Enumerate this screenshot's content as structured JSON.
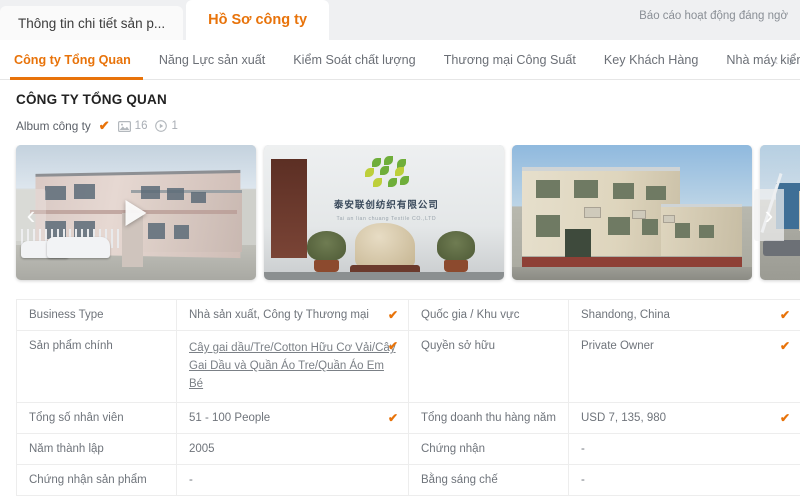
{
  "topbar": {
    "tabs": [
      {
        "label": "Thông tin chi tiết sản p...",
        "active": false
      },
      {
        "label": "Hồ Sơ công ty",
        "active": true
      }
    ],
    "report_link": "Báo cáo hoạt động đáng ngờ"
  },
  "nav": {
    "items": [
      {
        "label": "Công ty Tổng Quan",
        "active": true
      },
      {
        "label": "Năng Lực sản xuất",
        "active": false
      },
      {
        "label": "Kiểm Soát chất lượng",
        "active": false
      },
      {
        "label": "Thương mại Công Suất",
        "active": false
      },
      {
        "label": "Key Khách Hàng",
        "active": false
      },
      {
        "label": "Nhà máy kiểm tra",
        "active": false
      }
    ],
    "prev_arrow": "‹",
    "next_arrow": "›"
  },
  "section": {
    "title": "CÔNG TY TỔNG QUAN",
    "album_label": "Album công ty",
    "verified_mark": "✔",
    "photo_count": "16",
    "video_count": "1"
  },
  "carousel": {
    "prev_arrow": "‹",
    "next_arrow": "›",
    "slides": [
      {
        "name": "factory-exterior-video",
        "has_play": true
      },
      {
        "name": "company-lobby-sign",
        "has_play": false
      },
      {
        "name": "office-building",
        "has_play": false
      },
      {
        "name": "street-view-partial",
        "has_play": false
      }
    ],
    "lobby_sign_cn": "泰安联创纺织有限公司",
    "lobby_sign_en": "Tai an lian chuang Textile  CO.,LTD"
  },
  "info_table": {
    "rows": [
      {
        "left_label": "Business Type",
        "left_value": "Nhà sản xuất, Công ty Thương mại",
        "left_tick": true,
        "left_link": false,
        "right_label": "Quốc gia / Khu vực",
        "right_value": "Shandong, China",
        "right_tick": true
      },
      {
        "left_label": "Sản phẩm chính",
        "left_value": "Cây gai dầu/Tre/Cotton Hữu Cơ Vải/Cây Gai Dầu và Quần Áo Tre/Quần Áo Em Bé",
        "left_tick": true,
        "left_link": true,
        "right_label": "Quyền sở hữu",
        "right_value": "Private Owner",
        "right_tick": true
      },
      {
        "left_label": "Tổng số nhân viên",
        "left_value": "51 - 100 People",
        "left_tick": true,
        "left_link": false,
        "right_label": "Tổng doanh thu hàng năm",
        "right_value": "USD 7, 135, 980",
        "right_tick": true
      },
      {
        "left_label": "Năm thành lập",
        "left_value": "2005",
        "left_tick": false,
        "left_link": false,
        "right_label": "Chứng nhận",
        "right_value": "-",
        "right_tick": false
      },
      {
        "left_label": "Chứng nhận sản phẩm",
        "left_value": "-",
        "left_tick": false,
        "left_link": false,
        "right_label": "Bằng sáng chế",
        "right_value": "-",
        "right_tick": false
      }
    ]
  },
  "colors": {
    "accent": "#e8730a",
    "topbar_bg": "#eff0f2",
    "text_muted": "#8a8f96"
  }
}
